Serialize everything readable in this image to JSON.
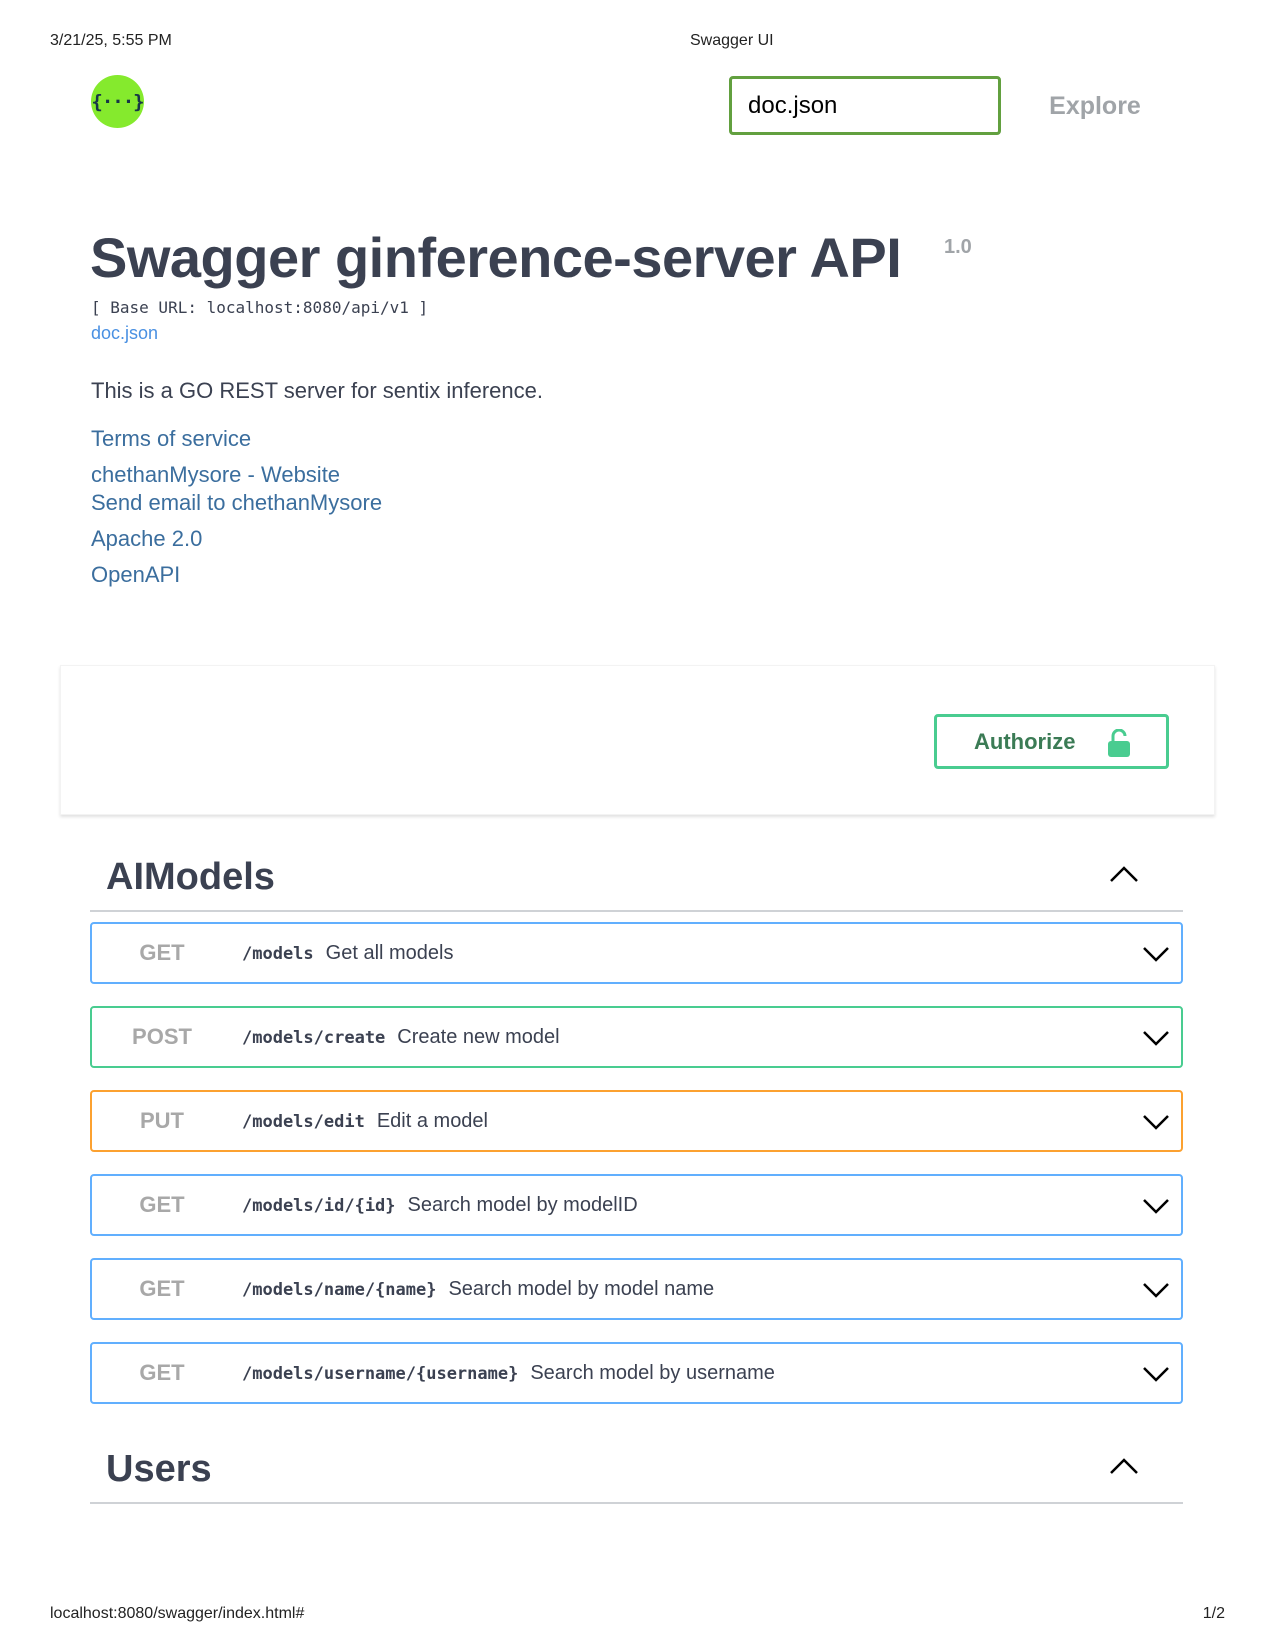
{
  "print_header": {
    "date": "3/21/25, 5:55 PM",
    "title": "Swagger UI"
  },
  "print_footer": {
    "url": "localhost:8080/swagger/index.html#",
    "page": "1/2"
  },
  "topbar": {
    "logo_icon": "swagger-logo-icon",
    "logo_glyph": "{···}",
    "url_value": "doc.json",
    "explore_label": "Explore"
  },
  "info": {
    "title": "Swagger ginference-server API",
    "version": "1.0",
    "base_url": "[ Base URL: localhost:8080/api/v1 ]",
    "spec_link": "doc.json",
    "description": "This is a GO REST server for sentix inference.",
    "links": {
      "terms": "Terms of service",
      "website": "chethanMysore - Website",
      "email": "Send email to chethanMysore",
      "license": "Apache 2.0",
      "openapi": "OpenAPI"
    }
  },
  "authorize": {
    "label": "Authorize",
    "icon": "lock-open-icon"
  },
  "colors": {
    "get": "#61affe",
    "post": "#49cc90",
    "put": "#fca130",
    "logo": "#85ea2d",
    "url_border": "#62a03f"
  },
  "tags": [
    {
      "name": "AIModels",
      "operations": [
        {
          "method": "GET",
          "path": "/models",
          "summary": "Get all models"
        },
        {
          "method": "POST",
          "path": "/models/create",
          "summary": "Create new model"
        },
        {
          "method": "PUT",
          "path": "/models/edit",
          "summary": "Edit a model"
        },
        {
          "method": "GET",
          "path": "/models/id/{id}",
          "summary": "Search model by modelID"
        },
        {
          "method": "GET",
          "path": "/models/name/{name}",
          "summary": "Search model by model name"
        },
        {
          "method": "GET",
          "path": "/models/username/{username}",
          "summary": "Search model by username"
        }
      ]
    },
    {
      "name": "Users",
      "operations": []
    }
  ]
}
